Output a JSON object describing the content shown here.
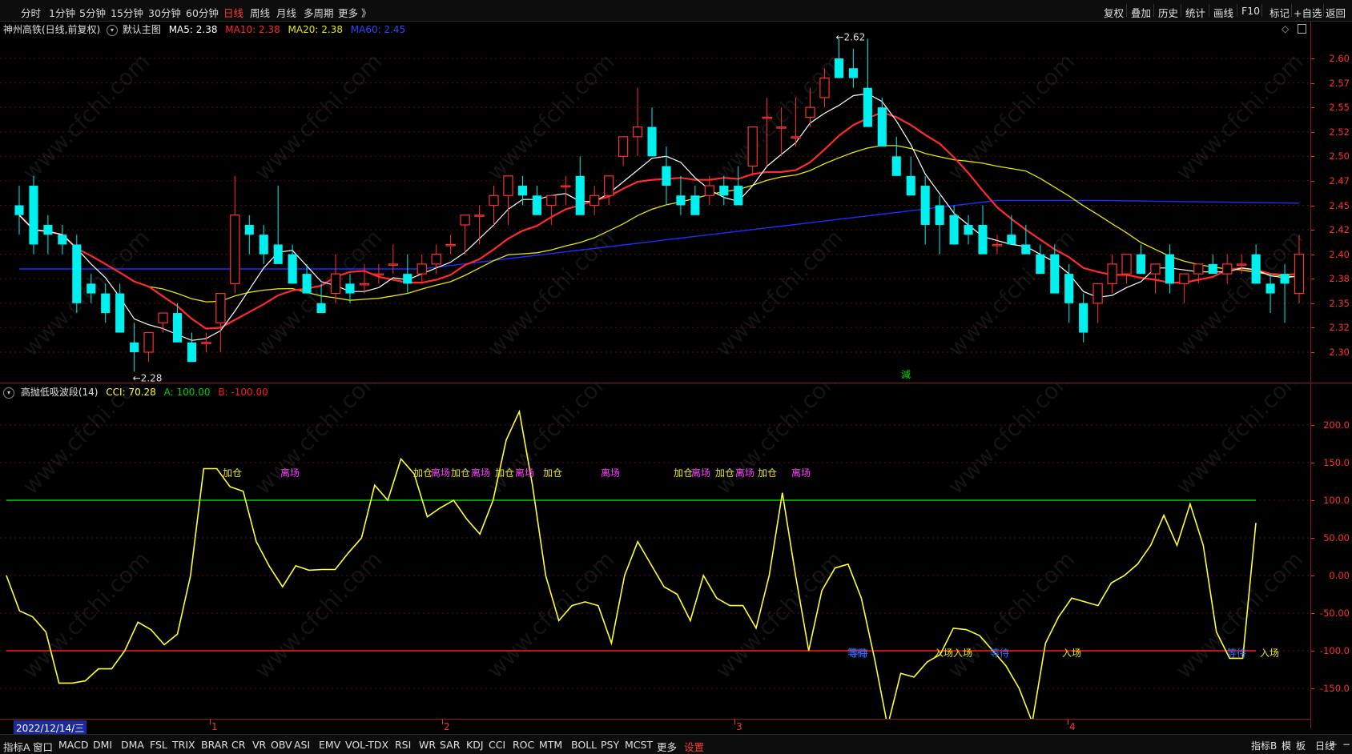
{
  "toolbar": {
    "periods": [
      "分时",
      "1分钟",
      "5分钟",
      "15分钟",
      "30分钟",
      "60分钟",
      "日线",
      "周线",
      "月线",
      "多周期",
      "更多 》"
    ],
    "active_period": "日线",
    "tools": [
      "复权",
      "叠加",
      "历史",
      "统计",
      "画线",
      "F10",
      "标记",
      "+自选",
      "返回"
    ]
  },
  "main": {
    "stock_title": "神州高铁(日线,前复权)",
    "main_chart_name": "默认主图",
    "ma5_label": "MA5: 2.38",
    "ma10_label": "MA10: 2.38",
    "ma20_label": "MA20: 2.38",
    "ma60_label": "MA60: 2.45",
    "high_label": "2.62",
    "low_label": "2.28",
    "signal_char": "減",
    "price_ticks": [
      "2.60",
      "2.57",
      "2.55",
      "2.52",
      "2.50",
      "2.47",
      "2.45",
      "2.42",
      "2.40",
      "2.38",
      "2.35",
      "2.32",
      "2.30"
    ]
  },
  "indicator": {
    "name": "高抛低吸波段(14)",
    "cci_label": "CCI: 70.28",
    "a_label": "A: 100.00",
    "b_label": "B: -100.00",
    "ticks": [
      "200.0",
      "150.0",
      "100.0",
      "50.00",
      "0.00",
      "-50.00",
      "-100.0",
      "-150.0"
    ],
    "signals": [
      {
        "text": "加仓",
        "color": "#e8e800"
      },
      {
        "text": "离场",
        "color": "#ff40ff"
      },
      {
        "text": "加仓",
        "color": "#e8e800"
      },
      {
        "text": "离场",
        "color": "#ff40ff"
      },
      {
        "text": "加仓",
        "color": "#e8e800"
      },
      {
        "text": "离场",
        "color": "#ff40ff"
      },
      {
        "text": "加仓",
        "color": "#e8e800"
      },
      {
        "text": "离场",
        "color": "#ff40ff"
      },
      {
        "text": "加仓",
        "color": "#e8e800"
      },
      {
        "text": "离场",
        "color": "#ff40ff"
      },
      {
        "text": "加仓",
        "color": "#e8e800"
      },
      {
        "text": "离场",
        "color": "#ff40ff"
      },
      {
        "text": "加仓",
        "color": "#e8e800"
      },
      {
        "text": "离场",
        "color": "#ff40ff"
      },
      {
        "text": "加仓",
        "color": "#e8e800"
      },
      {
        "text": "离场",
        "color": "#ff40ff"
      },
      {
        "text": "等待",
        "color": "#3a6bff"
      },
      {
        "text": "入场",
        "color": "#e8e800"
      },
      {
        "text": "等待",
        "color": "#3a6bff"
      },
      {
        "text": "入场",
        "color": "#e8e800"
      },
      {
        "text": "等待",
        "color": "#3a6bff"
      },
      {
        "text": "入场",
        "color": "#e8e800"
      },
      {
        "text": "等待",
        "color": "#3a6bff"
      },
      {
        "text": "入场",
        "color": "#e8e800"
      }
    ]
  },
  "dateaxis": {
    "current_date": "2022/12/14/三",
    "month_labels": [
      "1",
      "2",
      "3",
      "4"
    ]
  },
  "bottombar": {
    "tabs": [
      "指标A",
      "窗口",
      "MACD",
      "DMI",
      "DMA",
      "FSL",
      "TRIX",
      "BRAR",
      "CR",
      "VR",
      "OBV",
      "ASI",
      "EMV",
      "VOL-TDX",
      "RSI",
      "WR",
      "SAR",
      "KDJ",
      "CCI",
      "ROC",
      "MTM",
      "BOLL",
      "PSY",
      "MCST",
      "更多",
      "设置"
    ],
    "right": [
      "指标B",
      "模",
      "板",
      "日线",
      "+",
      "−"
    ]
  },
  "watermark": "www.cfchi.com",
  "colors": {
    "up": "#ff3030",
    "down": "#00f0f0",
    "ma5": "#ffffff",
    "ma10": "#ff2a2a",
    "ma20": "#e6e600",
    "ma60": "#1a2fff",
    "cci": "#ffff33",
    "line_a": "#00d000",
    "line_b": "#ff1a1a"
  },
  "chart_data": [
    {
      "type": "candlestick",
      "title": "神州高铁(日线,前复权)",
      "ylim": [
        2.28,
        2.62
      ],
      "x": [
        "1",
        "2",
        "3",
        "4"
      ],
      "ohlc": [
        [
          2.45,
          2.47,
          2.42,
          2.44
        ],
        [
          2.47,
          2.48,
          2.4,
          2.41
        ],
        [
          2.43,
          2.44,
          2.4,
          2.42
        ],
        [
          2.42,
          2.43,
          2.4,
          2.41
        ],
        [
          2.41,
          2.42,
          2.34,
          2.35
        ],
        [
          2.37,
          2.38,
          2.35,
          2.36
        ],
        [
          2.36,
          2.37,
          2.33,
          2.34
        ],
        [
          2.36,
          2.37,
          2.32,
          2.32
        ],
        [
          2.31,
          2.33,
          2.28,
          2.3
        ],
        [
          2.3,
          2.32,
          2.29,
          2.32
        ],
        [
          2.33,
          2.34,
          2.32,
          2.34
        ],
        [
          2.34,
          2.35,
          2.31,
          2.31
        ],
        [
          2.31,
          2.32,
          2.29,
          2.29
        ],
        [
          2.31,
          2.32,
          2.3,
          2.31
        ],
        [
          2.33,
          2.35,
          2.3,
          2.36
        ],
        [
          2.37,
          2.48,
          2.36,
          2.44
        ],
        [
          2.43,
          2.44,
          2.4,
          2.42
        ],
        [
          2.42,
          2.43,
          2.39,
          2.4
        ],
        [
          2.41,
          2.47,
          2.4,
          2.39
        ],
        [
          2.4,
          2.41,
          2.37,
          2.37
        ],
        [
          2.38,
          2.39,
          2.36,
          2.36
        ],
        [
          2.35,
          2.37,
          2.34,
          2.34
        ],
        [
          2.36,
          2.4,
          2.35,
          2.38
        ],
        [
          2.37,
          2.38,
          2.35,
          2.36
        ],
        [
          2.37,
          2.39,
          2.36,
          2.37
        ],
        [
          2.38,
          2.39,
          2.37,
          2.38
        ],
        [
          2.39,
          2.41,
          2.38,
          2.39
        ],
        [
          2.38,
          2.4,
          2.36,
          2.37
        ],
        [
          2.38,
          2.4,
          2.37,
          2.39
        ],
        [
          2.39,
          2.41,
          2.38,
          2.4
        ],
        [
          2.41,
          2.42,
          2.4,
          2.41
        ],
        [
          2.43,
          2.44,
          2.4,
          2.44
        ],
        [
          2.44,
          2.45,
          2.41,
          2.44
        ],
        [
          2.45,
          2.47,
          2.43,
          2.46
        ],
        [
          2.46,
          2.48,
          2.43,
          2.48
        ],
        [
          2.47,
          2.48,
          2.45,
          2.46
        ],
        [
          2.46,
          2.47,
          2.44,
          2.44
        ],
        [
          2.45,
          2.46,
          2.43,
          2.46
        ],
        [
          2.47,
          2.48,
          2.45,
          2.47
        ],
        [
          2.48,
          2.5,
          2.46,
          2.44
        ],
        [
          2.45,
          2.47,
          2.44,
          2.46
        ],
        [
          2.46,
          2.48,
          2.45,
          2.48
        ],
        [
          2.5,
          2.52,
          2.49,
          2.52
        ],
        [
          2.52,
          2.57,
          2.5,
          2.53
        ],
        [
          2.53,
          2.55,
          2.5,
          2.5
        ],
        [
          2.49,
          2.51,
          2.45,
          2.47
        ],
        [
          2.46,
          2.48,
          2.44,
          2.45
        ],
        [
          2.46,
          2.47,
          2.44,
          2.44
        ],
        [
          2.46,
          2.48,
          2.45,
          2.47
        ],
        [
          2.47,
          2.48,
          2.45,
          2.46
        ],
        [
          2.47,
          2.49,
          2.46,
          2.45
        ],
        [
          2.49,
          2.53,
          2.48,
          2.53
        ],
        [
          2.54,
          2.56,
          2.49,
          2.54
        ],
        [
          2.53,
          2.55,
          2.5,
          2.53
        ],
        [
          2.52,
          2.56,
          2.51,
          2.52
        ],
        [
          2.54,
          2.57,
          2.53,
          2.55
        ],
        [
          2.56,
          2.59,
          2.55,
          2.58
        ],
        [
          2.6,
          2.62,
          2.58,
          2.58
        ],
        [
          2.59,
          2.61,
          2.57,
          2.58
        ],
        [
          2.57,
          2.62,
          2.56,
          2.53
        ],
        [
          2.55,
          2.56,
          2.51,
          2.51
        ],
        [
          2.5,
          2.52,
          2.48,
          2.48
        ],
        [
          2.48,
          2.5,
          2.46,
          2.46
        ],
        [
          2.47,
          2.48,
          2.41,
          2.43
        ],
        [
          2.45,
          2.46,
          2.4,
          2.43
        ],
        [
          2.44,
          2.45,
          2.42,
          2.41
        ],
        [
          2.43,
          2.44,
          2.41,
          2.42
        ],
        [
          2.43,
          2.45,
          2.4,
          2.4
        ],
        [
          2.41,
          2.42,
          2.4,
          2.41
        ],
        [
          2.42,
          2.44,
          2.41,
          2.41
        ],
        [
          2.41,
          2.43,
          2.4,
          2.4
        ],
        [
          2.4,
          2.41,
          2.38,
          2.38
        ],
        [
          2.4,
          2.41,
          2.36,
          2.36
        ],
        [
          2.38,
          2.39,
          2.33,
          2.35
        ],
        [
          2.35,
          2.36,
          2.31,
          2.32
        ],
        [
          2.35,
          2.36,
          2.33,
          2.37
        ],
        [
          2.37,
          2.4,
          2.36,
          2.39
        ],
        [
          2.38,
          2.4,
          2.37,
          2.4
        ],
        [
          2.4,
          2.41,
          2.38,
          2.38
        ],
        [
          2.38,
          2.39,
          2.36,
          2.39
        ],
        [
          2.4,
          2.41,
          2.36,
          2.37
        ],
        [
          2.37,
          2.38,
          2.35,
          2.38
        ],
        [
          2.38,
          2.39,
          2.37,
          2.39
        ],
        [
          2.39,
          2.4,
          2.38,
          2.38
        ],
        [
          2.38,
          2.4,
          2.37,
          2.39
        ],
        [
          2.39,
          2.4,
          2.38,
          2.39
        ],
        [
          2.4,
          2.41,
          2.37,
          2.37
        ],
        [
          2.37,
          2.38,
          2.34,
          2.36
        ],
        [
          2.38,
          2.39,
          2.33,
          2.37
        ],
        [
          2.36,
          2.42,
          2.35,
          2.4
        ]
      ],
      "series": [
        {
          "name": "MA5",
          "color": "#ffffff"
        },
        {
          "name": "MA10",
          "color": "#ff2a2a"
        },
        {
          "name": "MA20",
          "color": "#e6e600"
        },
        {
          "name": "MA60",
          "color": "#1a2fff"
        }
      ]
    },
    {
      "type": "line",
      "title": "高抛低吸波段(14)",
      "ylim": [
        -200,
        220
      ],
      "series": [
        {
          "name": "CCI",
          "values": [
            0,
            -47,
            -55,
            -75,
            -143,
            -143,
            -140,
            -124,
            -124,
            -100,
            -62,
            -72,
            -92,
            -78,
            0,
            142,
            142,
            118,
            112,
            45,
            12,
            -15,
            13,
            7,
            8,
            8,
            30,
            50,
            120,
            100,
            155,
            135,
            78,
            90,
            100,
            75,
            55,
            100,
            180,
            218,
            120,
            0,
            -60,
            -40,
            -35,
            -40,
            -90,
            0,
            45,
            15,
            -15,
            -25,
            -60,
            0,
            -30,
            -40,
            -40,
            -70,
            0,
            110,
            0,
            -100,
            -20,
            10,
            15,
            -30,
            -110,
            -200,
            -130,
            -135,
            -115,
            -105,
            -70,
            -72,
            -80,
            -100,
            -120,
            -150,
            -195,
            -90,
            -55,
            -30,
            -35,
            -40,
            -10,
            0,
            15,
            40,
            80,
            40,
            95,
            40,
            -75,
            -110,
            -110,
            70
          ]
        },
        {
          "name": "A",
          "values": [
            100
          ]
        },
        {
          "name": "B",
          "values": [
            -100
          ]
        }
      ]
    }
  ]
}
